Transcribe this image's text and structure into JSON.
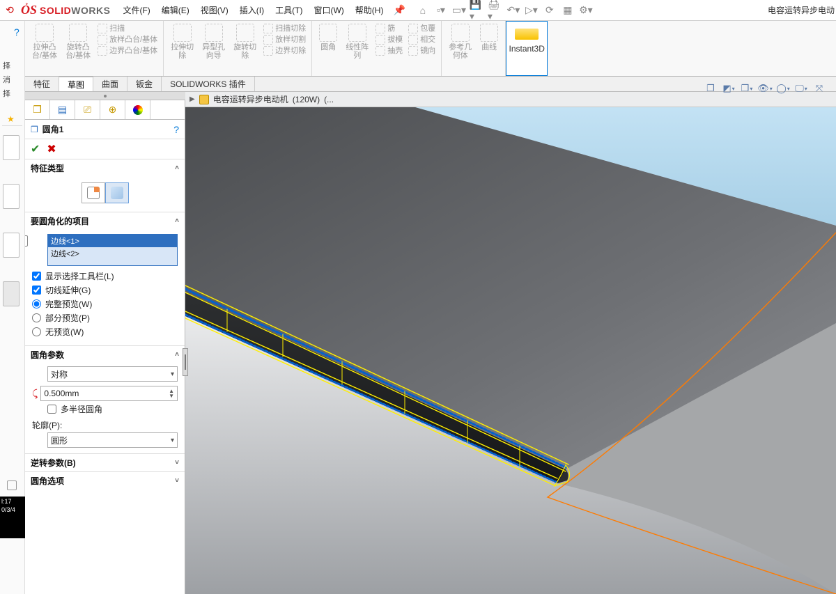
{
  "app": {
    "documentTitle": "电容运转异步电动"
  },
  "menu": {
    "file": "文件(F)",
    "edit": "编辑(E)",
    "view": "视图(V)",
    "insert": "插入(I)",
    "tools": "工具(T)",
    "window": "窗口(W)",
    "help": "帮助(H)"
  },
  "helpStrip": {
    "a": "择",
    "b": "消",
    "c": "择",
    "time1": "l:17",
    "time2": "0/3/4"
  },
  "ribbon": {
    "g1_big1": "拉伸凸\n台/基体",
    "g1_big2": "旋转凸\n台/基体",
    "g1_s1": "扫描",
    "g1_s2": "放样凸台/基体",
    "g1_s3": "边界凸台/基体",
    "g2_big1": "拉伸切\n除",
    "g2_big2": "异型孔\n向导",
    "g2_big3": "旋转切\n除",
    "g2_s1": "扫描切除",
    "g2_s2": "放样切割",
    "g2_s3": "边界切除",
    "g3_b1": "圆角",
    "g3_b2": "线性阵\n列",
    "g3_s1": "筋",
    "g3_s2": "拔模",
    "g3_s3": "抽壳",
    "g3_s4": "包覆",
    "g3_s5": "相交",
    "g3_s6": "镜向",
    "g4_b1": "参考几\n何体",
    "g4_b2": "曲线",
    "g4_instant": "Instant3D"
  },
  "ribbonTabs": {
    "t1": "特征",
    "t2": "草图",
    "t3": "曲面",
    "t4": "钣金",
    "t5": "SOLIDWORKS 插件"
  },
  "crumb": {
    "part": "电容运转异步电动机",
    "power": "(120W)",
    "dots": "(..."
  },
  "panel": {
    "featureName": "圆角1",
    "sec1": "特征类型",
    "sec2": "要圆角化的项目",
    "edge1": "边线<1>",
    "edge2": "边线<2>",
    "chk1": "显示选择工具栏(L)",
    "chk2": "切线延伸(G)",
    "r1": "完整预览(W)",
    "r2": "部分预览(P)",
    "r3": "无预览(W)",
    "sec3": "圆角参数",
    "symmetry": "对称",
    "radius": "0.500mm",
    "chk3": "多半径圆角",
    "profileLabel": "轮廓(P):",
    "profile": "圆形",
    "sec4": "逆转参数(B)",
    "sec5": "圆角选项"
  }
}
